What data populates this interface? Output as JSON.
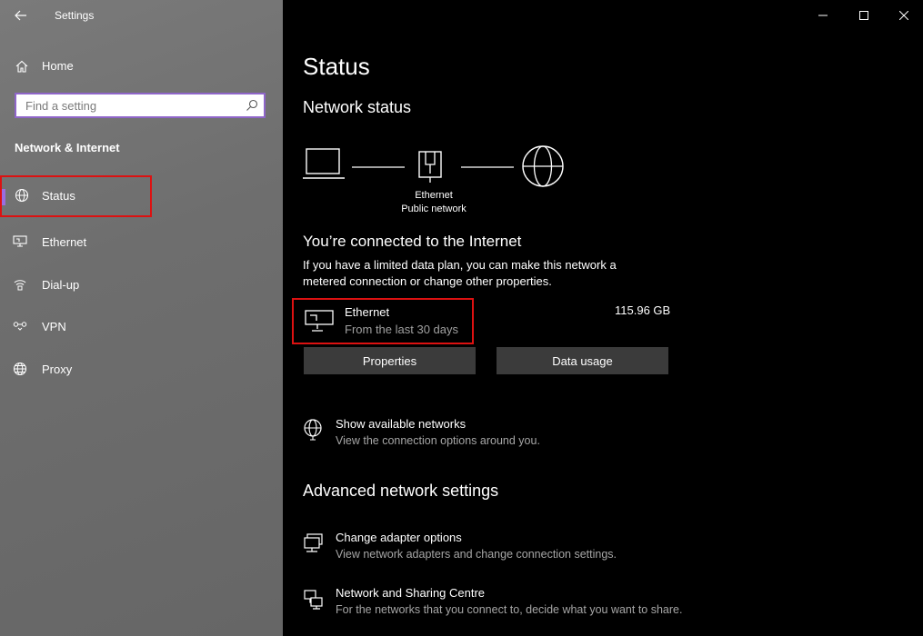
{
  "window": {
    "title": "Settings"
  },
  "sidebar": {
    "home_label": "Home",
    "search_placeholder": "Find a setting",
    "section_title": "Network & Internet",
    "items": [
      {
        "label": "Status",
        "icon": "globe-wired-icon",
        "active": true
      },
      {
        "label": "Ethernet",
        "icon": "ethernet-icon"
      },
      {
        "label": "Dial-up",
        "icon": "dialup-icon"
      },
      {
        "label": "VPN",
        "icon": "vpn-icon"
      },
      {
        "label": "Proxy",
        "icon": "globe-icon"
      }
    ]
  },
  "main": {
    "title": "Status",
    "network_status_heading": "Network status",
    "diagram": {
      "adapter_name": "Ethernet",
      "network_type": "Public network"
    },
    "connected_title": "You’re connected to the Internet",
    "connected_desc": "If you have a limited data plan, you can make this network a metered connection or change other properties.",
    "connection": {
      "name": "Ethernet",
      "period": "From the last 30 days",
      "usage": "115.96 GB"
    },
    "buttons": {
      "properties": "Properties",
      "data_usage": "Data usage"
    },
    "show_networks": {
      "title": "Show available networks",
      "desc": "View the connection options around you."
    },
    "advanced_heading": "Advanced network settings",
    "adapter_options": {
      "title": "Change adapter options",
      "desc": "View network adapters and change connection settings."
    },
    "sharing_centre": {
      "title": "Network and Sharing Centre",
      "desc": "For the networks that you connect to, decide what you want to share."
    }
  },
  "colors": {
    "accent": "#9b6de0",
    "highlight_border": "#dd1111",
    "button_bg": "#3b3b3b"
  }
}
